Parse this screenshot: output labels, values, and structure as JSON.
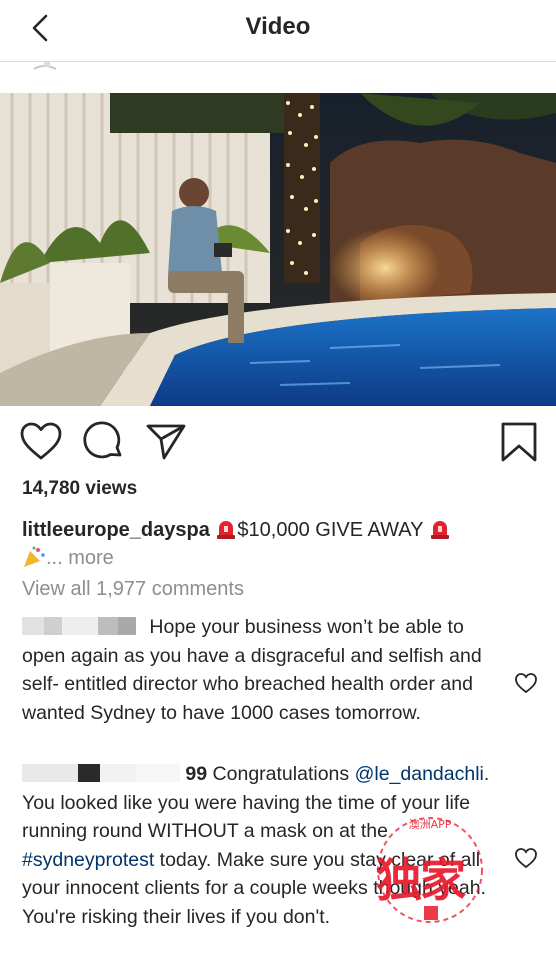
{
  "header": {
    "title": "Video"
  },
  "post": {
    "views": "14,780 views",
    "caption": {
      "username": "littleeurope_dayspa",
      "text": "$10,000 GIVE AWAY",
      "more_ellipsis": "...",
      "more": "more"
    },
    "view_all_comments": "View all 1,977 comments"
  },
  "comments": [
    {
      "username_suffix": "",
      "text": "Hope your business won’t be able to open again as you have a disgraceful and selfish and self- entitled director who breached health order and wanted Sydney to have 1000 cases tomorrow."
    },
    {
      "username_suffix": "99",
      "text_start": "Congratulations",
      "mention": "@le_dandachli",
      "text_mid": ". You looked like you were having the time of your life running round WITHOUT a mask on at the",
      "hashtag": "#sydneyprotest",
      "text_end": "today. Make sure you stay clear of all your innocent clients for a couple weeks though yeah. You're risking their lives if you don't."
    }
  ],
  "watermark": {
    "main": "独家",
    "ring": "澳洲APP"
  },
  "icons": {
    "back": "chevron-left-icon",
    "like": "heart-icon",
    "comment": "comment-bubble-icon",
    "share": "paper-plane-icon",
    "save": "bookmark-icon",
    "siren": "police-light-icon",
    "party": "party-popper-icon"
  },
  "colors": {
    "link": "#003569",
    "muted": "#8e8e8e",
    "text": "#262626",
    "watermark": "#e8192c"
  }
}
